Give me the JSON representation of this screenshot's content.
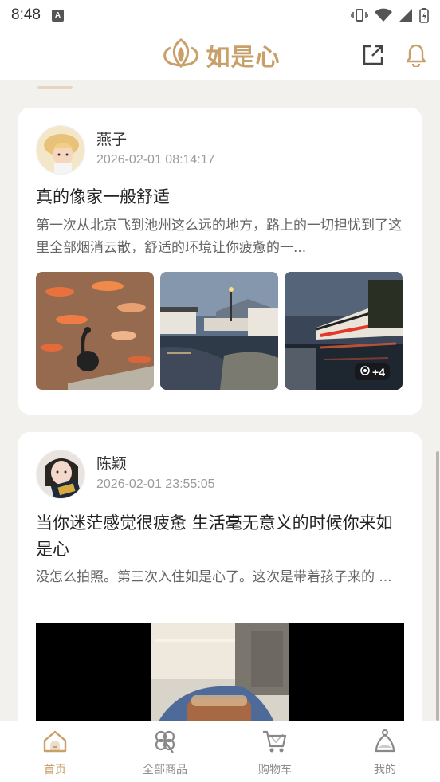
{
  "status_bar": {
    "time": "8:48",
    "app_icon_letter": "A",
    "icons": [
      "vibrate-icon",
      "wifi-icon",
      "signal-icon",
      "battery-charging-icon"
    ]
  },
  "header": {
    "brand_name": "如是心",
    "actions": [
      "share-icon",
      "bell-icon"
    ]
  },
  "colors": {
    "accent": "#c7a06a",
    "background": "#f3f1ed",
    "card": "#ffffff",
    "muted_text": "#9b9b9b"
  },
  "posts": [
    {
      "author": "燕子",
      "time": "2026-02-01 08:14:17",
      "title": "真的像家一般舒适",
      "excerpt": "第一次从北京飞到池州这么远的地方，路上的一切担忧到了这里全部烟消云散，舒适的环境让你疲惫的一...",
      "more_count": "+4"
    },
    {
      "author": "陈颖",
      "time": "2026-02-01 23:55:05",
      "title": "当你迷茫感觉很疲惫 生活毫无意义的时候你来如是心",
      "excerpt": "没怎么拍照。第三次入住如是心了。这次是带着孩子来的 ..."
    }
  ],
  "bottom_nav": {
    "items": [
      {
        "label": "首页",
        "icon": "home-icon",
        "active": true
      },
      {
        "label": "全部商品",
        "icon": "clover-icon",
        "active": false
      },
      {
        "label": "购物车",
        "icon": "cart-icon",
        "active": false
      },
      {
        "label": "我的",
        "icon": "profile-icon",
        "active": false
      }
    ]
  }
}
